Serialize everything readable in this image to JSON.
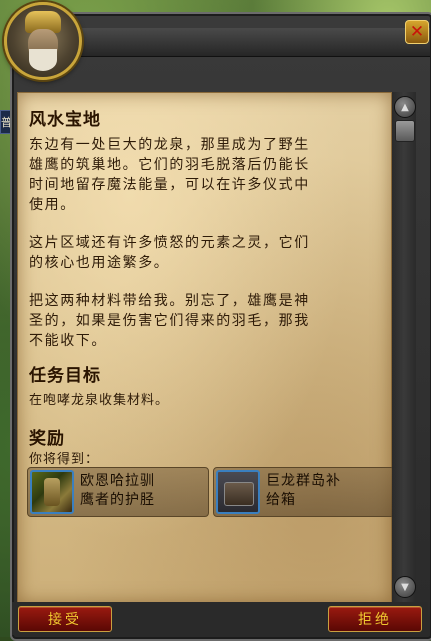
{
  "window": {
    "close_glyph": "✕",
    "portrait_icon": "npc-portrait"
  },
  "sidebar_fragment": "普",
  "quest": {
    "title": "风水宝地",
    "description_1": "东边有一处巨大的龙泉，那里成为了野生\n雄鹰的筑巢地。它们的羽毛脱落后仍能长\n时间地留存魔法能量，可以在许多仪式中\n使用。",
    "description_2": "这片区域还有许多愤怒的元素之灵，它们\n的核心也用途繁多。",
    "description_3": "把这两种材料带给我。别忘了，雄鹰是神\n圣的，如果是伤害它们得来的羽毛，那我\n不能收下。",
    "objectives_header": "任务目标",
    "objectives_text": "在咆哮龙泉收集材料。",
    "rewards_header": "奖励",
    "rewards_subtext": "你将得到：",
    "rewards": [
      {
        "name": "欧恩哈拉驯\n鹰者的护胫",
        "icon": "leg-armor-icon"
      },
      {
        "name": "巨龙群岛补\n给箱",
        "icon": "supply-chest-icon"
      }
    ]
  },
  "buttons": {
    "accept": "接受",
    "decline": "拒绝"
  },
  "colors": {
    "frame_gold": "#c9a53a",
    "button_red": "#9a1a10",
    "button_text": "#f0c830",
    "parchment": "#dcc595",
    "icon_border": "#3a7fbf"
  }
}
